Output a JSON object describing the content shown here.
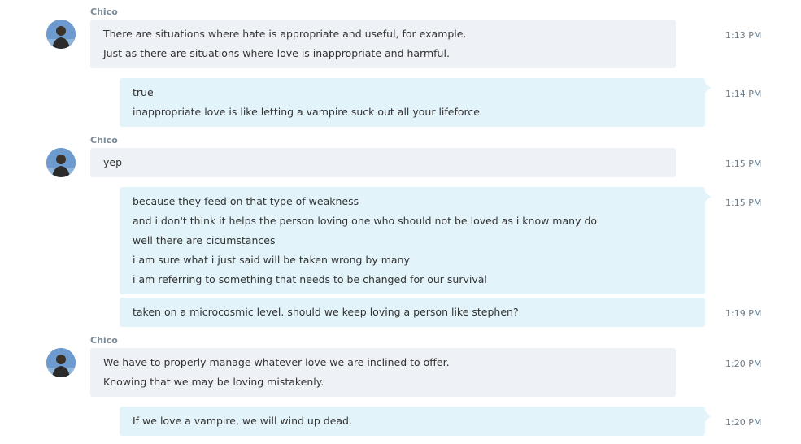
{
  "messages": [
    {
      "sender": "Chico",
      "lines": [
        "There are situations where hate is appropriate and useful, for example.",
        "Just as there are situations where love is inappropriate and harmful."
      ],
      "time": "1:13 PM"
    },
    {
      "lines": [
        "true",
        "inappropriate love is like letting a vampire suck out all your lifeforce"
      ],
      "time": "1:14 PM"
    },
    {
      "sender": "Chico",
      "lines": [
        "yep"
      ],
      "time": "1:15 PM"
    },
    {
      "lines": [
        "because they feed on that type of weakness",
        "and i don't think it helps the person loving one who should not be loved as i know many do",
        "well there are cicumstances",
        "i am sure what i just said will be taken wrong by many",
        "i am referring to something that needs to be changed for our survival"
      ],
      "time": "1:15 PM"
    },
    {
      "lines": [
        "taken on a microcosmic level.  should we keep loving a person like stephen?"
      ],
      "time": "1:19 PM"
    },
    {
      "sender": "Chico",
      "lines": [
        "We have to properly manage whatever love we are inclined to offer.",
        "Knowing that we may be loving mistakenly."
      ],
      "time": "1:20 PM"
    },
    {
      "lines": [
        "If we love a vampire, we will wind up dead."
      ],
      "time": "1:20 PM"
    }
  ],
  "colors": {
    "incoming_bubble": "#eef1f5",
    "outgoing_bubble": "#e3f3fa",
    "sender_name": "#7a8a96",
    "timestamp": "#6a7a86"
  }
}
